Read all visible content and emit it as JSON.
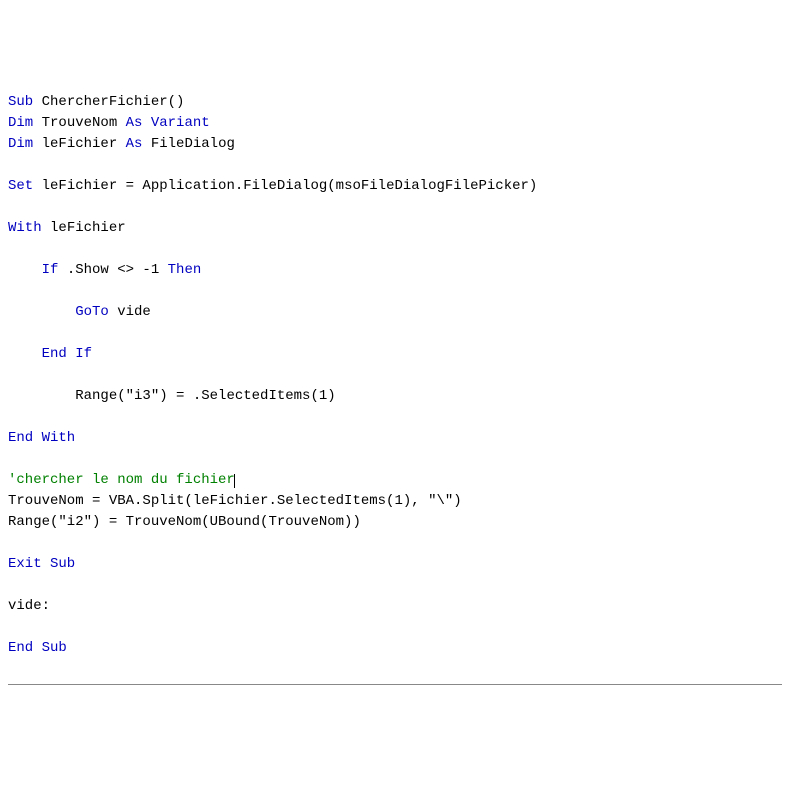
{
  "code": {
    "l1_kw1": "Sub",
    "l1_txt": " ChercherFichier()",
    "l2_kw1": "Dim",
    "l2_txt1": " TrouveNom ",
    "l2_kw2": "As Variant",
    "l3_kw1": "Dim",
    "l3_txt1": " leFichier ",
    "l3_kw2": "As",
    "l3_txt2": " FileDialog",
    "l5_kw1": "Set",
    "l5_txt": " leFichier = Application.FileDialog(msoFileDialogFilePicker)",
    "l7_kw1": "With",
    "l7_txt": " leFichier",
    "l9_pad": "    ",
    "l9_kw1": "If",
    "l9_txt1": " .Show <> -1 ",
    "l9_kw2": "Then",
    "l11_pad": "        ",
    "l11_kw1": "GoTo",
    "l11_txt": " vide",
    "l13_pad": "    ",
    "l13_kw1": "End If",
    "l15_pad": "        ",
    "l15_txt": "Range(\"i3\") = .SelectedItems(1)",
    "l17_kw1": "End With",
    "l19_cm": "'chercher le nom du fichier",
    "l20_txt": "TrouveNom = VBA.Split(leFichier.SelectedItems(1), \"\\\")",
    "l21_txt": "Range(\"i2\") = TrouveNom(UBound(TrouveNom))",
    "l23_kw1": "Exit Sub",
    "l25_txt": "vide:",
    "l27_kw1": "End Sub"
  }
}
